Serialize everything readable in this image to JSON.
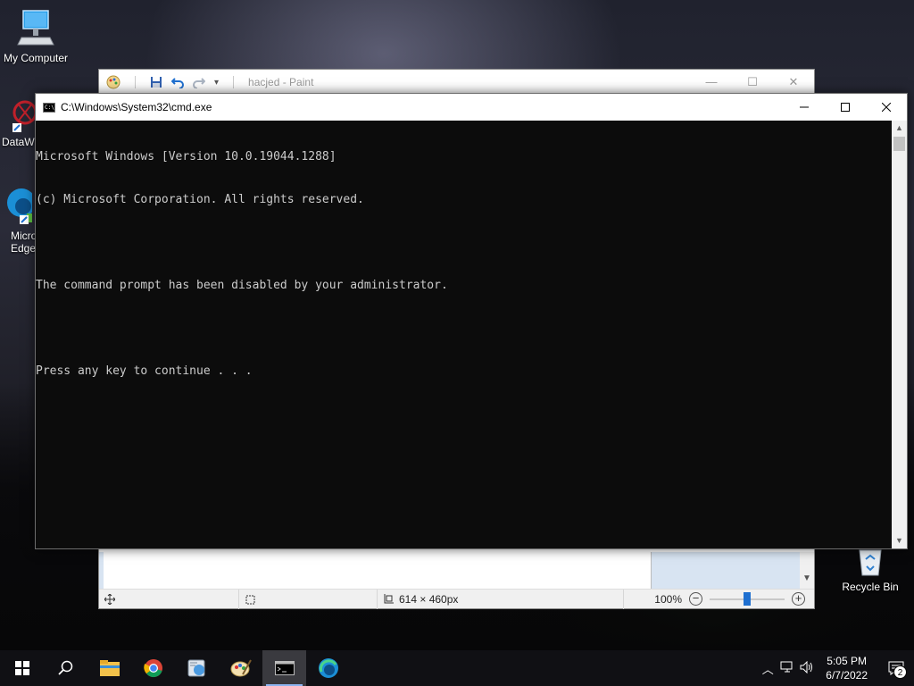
{
  "desktop": {
    "icons": [
      {
        "label": "My Computer"
      },
      {
        "label": "DataW"
      },
      {
        "label": "Micro Edge"
      },
      {
        "label": "Recycle Bin"
      }
    ]
  },
  "paint": {
    "title": "hacjed - Paint",
    "controls": {
      "minimize": "—",
      "maximize": "☐",
      "close": "✕"
    },
    "status": {
      "size": "614 × 460px",
      "zoom": "100%"
    }
  },
  "cmd": {
    "title": "C:\\Windows\\System32\\cmd.exe",
    "lines": [
      "Microsoft Windows [Version 10.0.19044.1288]",
      "(c) Microsoft Corporation. All rights reserved.",
      "",
      "The command prompt has been disabled by your administrator.",
      "",
      "Press any key to continue . . ."
    ]
  },
  "taskbar": {
    "apps": [
      {
        "name": "start-icon"
      },
      {
        "name": "search-icon"
      },
      {
        "name": "file-explorer-icon"
      },
      {
        "name": "chrome-icon"
      },
      {
        "name": "app-icon"
      },
      {
        "name": "paint-icon"
      },
      {
        "name": "cmd-icon",
        "active": true
      },
      {
        "name": "edge-icon"
      }
    ],
    "clock": {
      "time": "5:05 PM",
      "date": "6/7/2022"
    },
    "notifications": {
      "count": "2"
    }
  },
  "colors": {
    "cmd_background": "#0c0c0c",
    "cmd_text": "#cccccc",
    "taskbar": "#101014",
    "accent": "#1e6fd0"
  }
}
